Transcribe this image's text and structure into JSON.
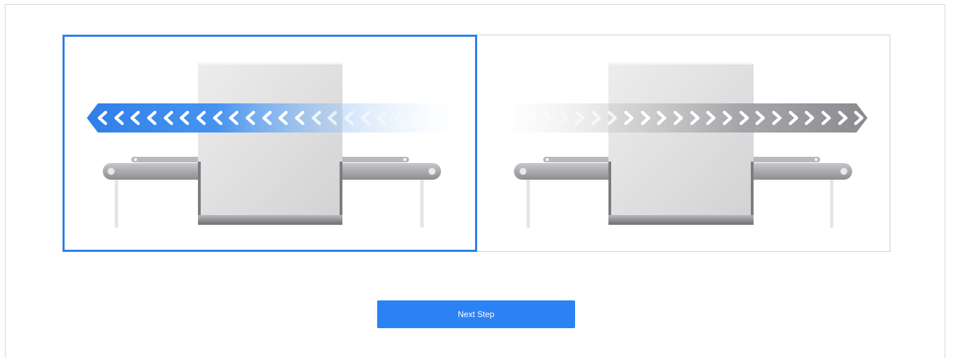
{
  "options": [
    {
      "id": "left",
      "direction": "left",
      "selected": true,
      "accent": "#2b7de9"
    },
    {
      "id": "right",
      "direction": "right",
      "selected": false,
      "accent": "#8a8a8a"
    }
  ],
  "next_button": {
    "label": "Next Step",
    "color": "#2b82f4"
  },
  "icons": {
    "left_illustration": "scanner-conveyor-left-flow-icon",
    "right_illustration": "scanner-conveyor-right-flow-icon"
  }
}
